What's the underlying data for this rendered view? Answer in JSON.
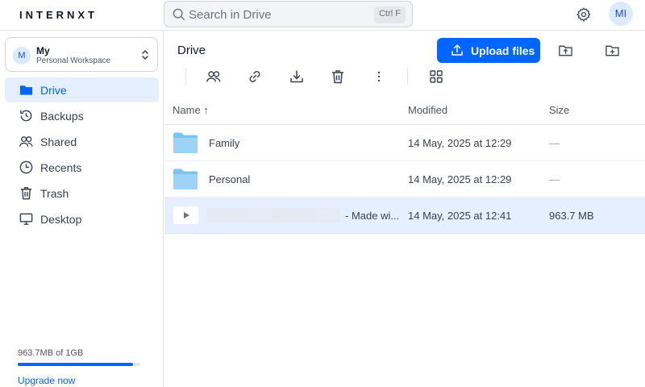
{
  "brand": {
    "logo": "INTERNXT"
  },
  "search": {
    "placeholder": "Search in Drive",
    "shortcut": "Ctrl F"
  },
  "header": {
    "settings_icon": "gear-icon",
    "avatar_initials": "MI"
  },
  "workspace": {
    "initial": "M",
    "name": "My",
    "subtitle": "Personal Workspace"
  },
  "sidebar": {
    "items": [
      {
        "label": "Drive",
        "icon": "folder-icon",
        "active": true
      },
      {
        "label": "Backups",
        "icon": "history-icon",
        "active": false
      },
      {
        "label": "Shared",
        "icon": "users-icon",
        "active": false
      },
      {
        "label": "Recents",
        "icon": "clock-icon",
        "active": false
      },
      {
        "label": "Trash",
        "icon": "trash-icon",
        "active": false
      },
      {
        "label": "Desktop",
        "icon": "desktop-icon",
        "active": false
      }
    ],
    "storage": {
      "usage_text": "963.7MB of 1GB",
      "used_fraction": 0.94,
      "upgrade_label": "Upgrade now"
    }
  },
  "main": {
    "title": "Drive",
    "upload_label": "Upload files",
    "columns": {
      "name": "Name",
      "sort_arrow": "↑",
      "modified": "Modified",
      "size": "Size"
    },
    "rows": [
      {
        "name": "Family",
        "type": "folder",
        "modified": "14 May, 2025 at 12:29",
        "size": "—",
        "selected": false
      },
      {
        "name": "Personal",
        "type": "folder",
        "modified": "14 May, 2025 at 12:29",
        "size": "—",
        "selected": false
      },
      {
        "name": "- Made wi...",
        "type": "video",
        "modified": "14 May, 2025 at 12:41",
        "size": "963.7 MB",
        "selected": true
      }
    ]
  },
  "colors": {
    "accent": "#0066ff",
    "selected_row": "#e5efff",
    "folder": "#7cc4f3"
  }
}
